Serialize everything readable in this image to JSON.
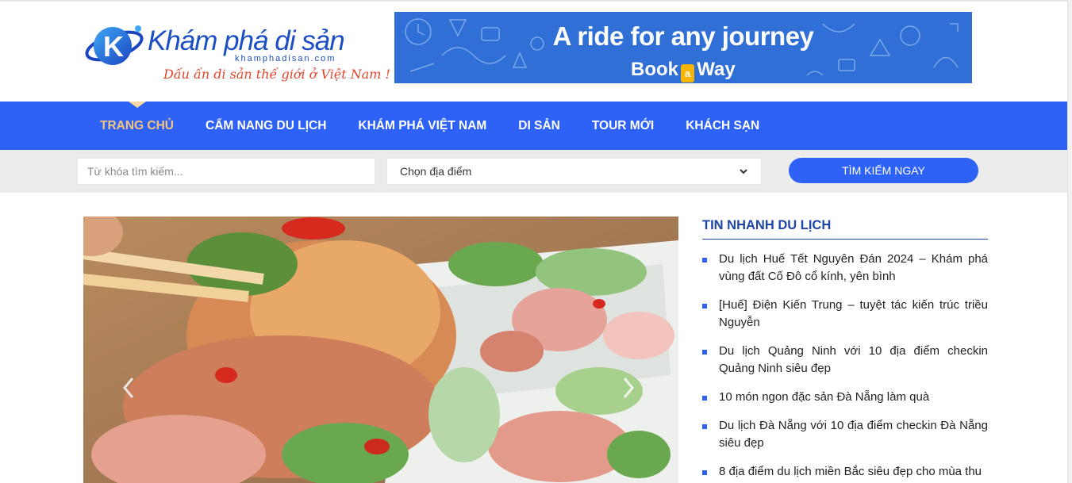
{
  "header": {
    "logo": {
      "title": "Khám phá di sản",
      "domain": "khamphadisan.com",
      "slogan": "Dấu ấn di sản thế giới ở Việt Nam !"
    },
    "banner": {
      "headline": "A ride for any journey",
      "brand_left": "Book",
      "brand_mid": "a",
      "brand_right": "Way"
    }
  },
  "nav": {
    "items": [
      {
        "label": "TRANG CHỦ",
        "active": true
      },
      {
        "label": "CẨM NANG DU LỊCH",
        "active": false
      },
      {
        "label": "KHÁM PHÁ VIỆT NAM",
        "active": false
      },
      {
        "label": "DI SẢN",
        "active": false
      },
      {
        "label": "TOUR MỚI",
        "active": false
      },
      {
        "label": "KHÁCH SẠN",
        "active": false
      }
    ]
  },
  "search": {
    "placeholder": "Từ khóa tìm kiếm...",
    "value": "",
    "location_selected": "Chọn địa điểm",
    "button_label": "TÌM KIẾM NGAY"
  },
  "sidebar": {
    "title": "TIN NHANH DU LỊCH",
    "items": [
      {
        "label": "Du lịch Huế Tết Nguyên Đán 2024 – Khám phá vùng đất Cố Đô cổ kính, yên bình"
      },
      {
        "label": "[Huế] Điện Kiến Trung – tuyệt tác kiến trúc triều Nguyễn"
      },
      {
        "label": "Du lịch Quảng Ninh với 10 địa điểm checkin Quảng Ninh siêu đẹp"
      },
      {
        "label": "10 món ngon đặc sản Đà Nẵng làm quà"
      },
      {
        "label": "Du lịch Đà Nẵng với 10 địa điểm checkin Đà Nẵng siêu đẹp"
      },
      {
        "label": "8 địa điểm du lịch miền Bắc siêu đẹp cho mùa thu"
      }
    ]
  },
  "icons": {
    "slider_prev": "chevron-left-icon",
    "slider_next": "chevron-right-icon",
    "select_arrow": "chevron-down-icon"
  },
  "colors": {
    "nav_bg": "#2e62f6",
    "nav_active": "#f4c57a",
    "brand_blue": "#1c4fc3",
    "slogan": "#e0442b",
    "sidebar_title": "#1d46a8"
  }
}
